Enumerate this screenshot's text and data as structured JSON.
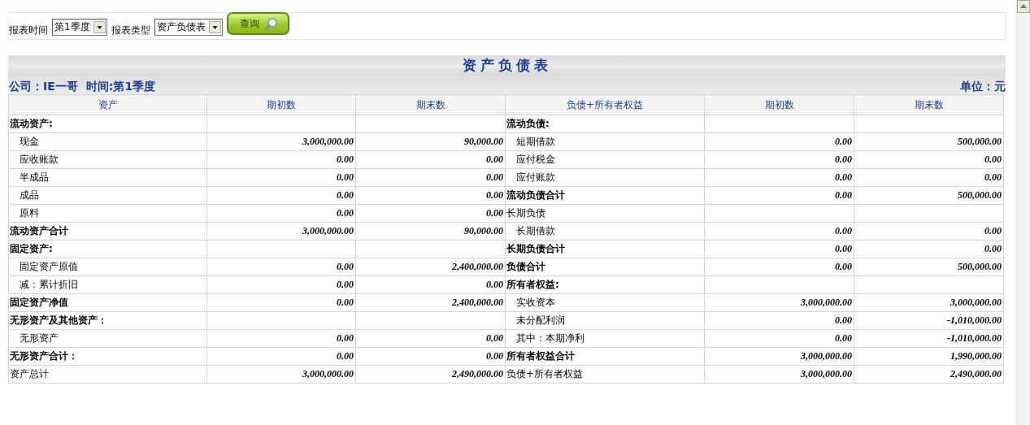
{
  "filters": [
    {
      "label": "报表时间",
      "value": "第1季度"
    },
    {
      "label": "报表类型",
      "value": "资产负债表"
    }
  ],
  "query_button": {
    "label": "查询"
  },
  "report": {
    "title": "资产负债表",
    "company": "公司：IE一哥",
    "period": "时间:第1季度",
    "unit": "单位：元",
    "columns": [
      "资产",
      "期初数",
      "期末数",
      "负债+所有者权益",
      "期初数",
      "期末数"
    ],
    "rows": [
      {
        "left": {
          "kind": "section",
          "label": "流动资产:"
        },
        "right": {
          "kind": "section",
          "label": "流动负债:"
        }
      },
      {
        "left": {
          "kind": "item",
          "label": "现金",
          "begin": "3,000,000.00",
          "end": "90,000.00"
        },
        "right": {
          "kind": "item",
          "label": "短期借款",
          "begin": "0.00",
          "end": "500,000.00"
        }
      },
      {
        "left": {
          "kind": "item",
          "label": "应收账款",
          "begin": "0.00",
          "end": "0.00"
        },
        "right": {
          "kind": "item",
          "label": "应付税金",
          "begin": "0.00",
          "end": "0.00"
        }
      },
      {
        "left": {
          "kind": "item",
          "label": "半成品",
          "begin": "0.00",
          "end": "0.00"
        },
        "right": {
          "kind": "item",
          "label": "应付账款",
          "begin": "0.00",
          "end": "0.00"
        }
      },
      {
        "left": {
          "kind": "item",
          "label": "成品",
          "begin": "0.00",
          "end": "0.00"
        },
        "right": {
          "kind": "total",
          "label": "流动负债合计",
          "begin": "0.00",
          "end": "500,000.00"
        }
      },
      {
        "left": {
          "kind": "item",
          "label": "原料",
          "begin": "0.00",
          "end": "0.00"
        },
        "right": {
          "kind": "plain",
          "label": "长期负债"
        }
      },
      {
        "left": {
          "kind": "total",
          "label": "流动资产合计",
          "begin": "3,000,000.00",
          "end": "90,000.00"
        },
        "right": {
          "kind": "item",
          "label": "长期借款",
          "begin": "0.00",
          "end": "0.00"
        }
      },
      {
        "left": {
          "kind": "section",
          "label": "固定资产:"
        },
        "right": {
          "kind": "total",
          "label": "长期负债合计",
          "begin": "0.00",
          "end": "0.00"
        }
      },
      {
        "left": {
          "kind": "item",
          "label": "固定资产原值",
          "begin": "0.00",
          "end": "2,400,000.00"
        },
        "right": {
          "kind": "total",
          "label": "负债合计",
          "begin": "0.00",
          "end": "500,000.00"
        }
      },
      {
        "left": {
          "kind": "item",
          "label": "减：累计折旧",
          "begin": "0.00",
          "end": "0.00"
        },
        "right": {
          "kind": "section",
          "label": "所有者权益:"
        }
      },
      {
        "left": {
          "kind": "total",
          "label": "固定资产净值",
          "begin": "0.00",
          "end": "2,400,000.00"
        },
        "right": {
          "kind": "item",
          "label": "实收资本",
          "begin": "3,000,000.00",
          "end": "3,000,000.00"
        }
      },
      {
        "left": {
          "kind": "section",
          "label": "无形资产及其他资产："
        },
        "right": {
          "kind": "item",
          "label": "未分配利润",
          "begin": "0.00",
          "end": "-1,010,000.00"
        }
      },
      {
        "left": {
          "kind": "item",
          "label": "无形资产",
          "begin": "0.00",
          "end": "0.00"
        },
        "right": {
          "kind": "item",
          "label": "其中：本期净利",
          "begin": "0.00",
          "end": "-1,010,000.00"
        }
      },
      {
        "left": {
          "kind": "total",
          "label": "无形资产合计：",
          "begin": "0.00",
          "end": "0.00"
        },
        "right": {
          "kind": "total",
          "label": "所有者权益合计",
          "begin": "3,000,000.00",
          "end": "1,990,000.00"
        }
      },
      {
        "left": {
          "kind": "plain",
          "label": "资产总计",
          "begin": "3,000,000.00",
          "end": "2,490,000.00"
        },
        "right": {
          "kind": "plain",
          "label": "负债+所有者权益",
          "begin": "3,000,000.00",
          "end": "2,490,000.00"
        }
      }
    ]
  }
}
